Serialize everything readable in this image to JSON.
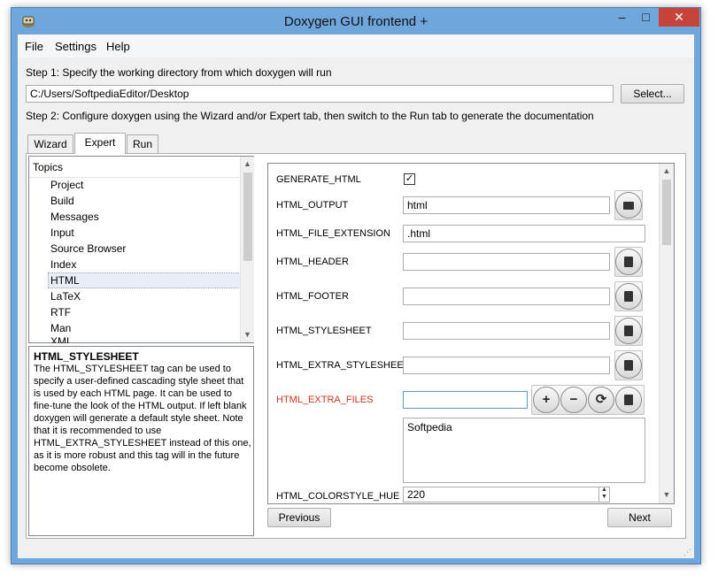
{
  "window": {
    "title": "Doxygen GUI frontend +"
  },
  "title_buttons": {
    "minimize": "–",
    "maximize": "□",
    "close": "✕"
  },
  "menu": {
    "file": "File",
    "settings": "Settings",
    "help": "Help"
  },
  "step1": {
    "label": "Step 1: Specify the working directory from which doxygen will run",
    "path": "C:/Users/SoftpediaEditor/Desktop",
    "select_button": "Select..."
  },
  "step2": {
    "label": "Step 2: Configure doxygen using the Wizard and/or Expert tab, then switch to the Run tab to generate the documentation"
  },
  "tabs": {
    "wizard": "Wizard",
    "expert": "Expert",
    "run": "Run",
    "active": "Expert"
  },
  "topics": {
    "header": "Topics",
    "items": [
      "Project",
      "Build",
      "Messages",
      "Input",
      "Source Browser",
      "Index",
      "HTML",
      "LaTeX",
      "RTF",
      "Man",
      "XML"
    ],
    "selected": "HTML"
  },
  "help": {
    "title": "HTML_STYLESHEET",
    "body": "The HTML_STYLESHEET tag can be used to specify a user-defined cascading style sheet that is used by each HTML page. It can be used to fine-tune the look of the HTML output. If left blank doxygen will generate a default style sheet. Note that it is recommended to use HTML_EXTRA_STYLESHEET instead of this one, as it is more robust and this tag will in the future become obsolete."
  },
  "settings": {
    "generate_html": {
      "label": "GENERATE_HTML",
      "checked": "✓"
    },
    "html_output": {
      "label": "HTML_OUTPUT",
      "value": "html"
    },
    "html_file_extension": {
      "label": "HTML_FILE_EXTENSION",
      "value": ".html"
    },
    "html_header": {
      "label": "HTML_HEADER",
      "value": ""
    },
    "html_footer": {
      "label": "HTML_FOOTER",
      "value": ""
    },
    "html_stylesheet": {
      "label": "HTML_STYLESHEET",
      "value": ""
    },
    "html_extra_stylesheet": {
      "label": "HTML_EXTRA_STYLESHEET",
      "value": ""
    },
    "html_extra_files": {
      "label": "HTML_EXTRA_FILES",
      "value": "",
      "list_items": [
        "Softpedia"
      ],
      "highlight_color": "#e0301e"
    },
    "html_colorstyle_hue": {
      "label": "HTML_COLORSTYLE_HUE",
      "value": "220"
    }
  },
  "nav": {
    "previous": "Previous",
    "next": "Next"
  },
  "icons": {
    "app": "doxygen-app-icon",
    "add": "+",
    "remove": "−",
    "refresh": "⟳",
    "scroll_up": "▲",
    "scroll_down": "▼",
    "spin_up": "▲",
    "spin_down": "▼"
  }
}
